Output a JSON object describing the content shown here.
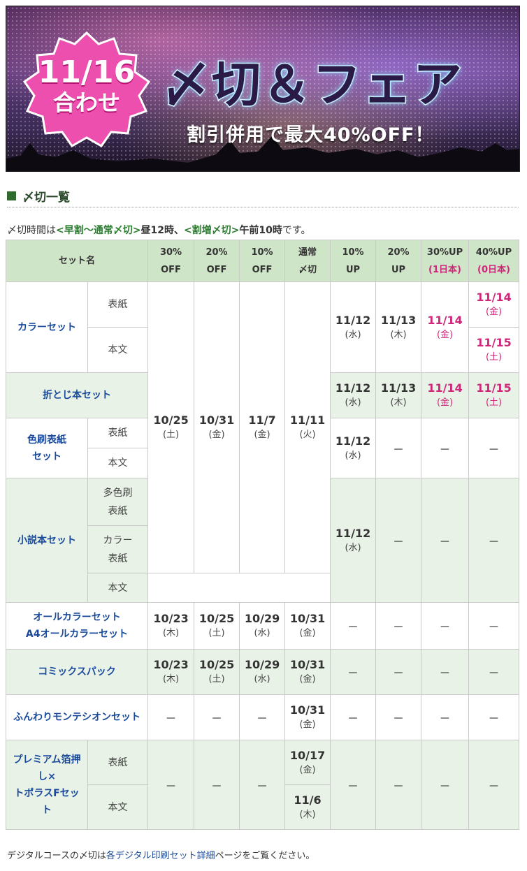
{
  "banner": {
    "badge_date": "11/16",
    "badge_sub": "合わせ",
    "title": "〆切＆フェア",
    "subtitle": "割引併用で最大40%OFF！",
    "colors": {
      "badge": "#ec4fae",
      "title": "#2a1a45",
      "glow": "#9fe3ff"
    }
  },
  "section": {
    "title": "〆切一覧"
  },
  "note": {
    "prefix": "〆切時間は",
    "early": "<早割〜通常〆切>",
    "early_time": "昼12時、",
    "extra": "<割増〆切>",
    "extra_time": "午前10時",
    "suffix": "です。"
  },
  "table": {
    "head": {
      "set_name": "セット名",
      "c1a": "30%",
      "c1b": "OFF",
      "c2a": "20%",
      "c2b": "OFF",
      "c3a": "10%",
      "c3b": "OFF",
      "c4a": "通常",
      "c4b": "〆切",
      "c5a": "10%",
      "c5b": "UP",
      "c6a": "20%",
      "c6b": "UP",
      "c7a": "30%UP",
      "c7b": "(1日本)",
      "c8a": "40%UP",
      "c8b": "(0日本)"
    },
    "dash": "－",
    "shared": {
      "off30": {
        "d": "10/25",
        "w": "(土)"
      },
      "off20": {
        "d": "10/31",
        "w": "(金)"
      },
      "off10": {
        "d": "11/7",
        "w": "(金)"
      },
      "normal": {
        "d": "11/11",
        "w": "(火)"
      }
    },
    "color_set": {
      "name": "カラーセット",
      "part1": "表紙",
      "part2": "本文",
      "up10": {
        "d": "11/12",
        "w": "(水)"
      },
      "up20": {
        "d": "11/13",
        "w": "(木)"
      },
      "up30": {
        "d": "11/14",
        "w": "(金)"
      },
      "up40_cover": {
        "d": "11/14",
        "w": "(金)"
      },
      "up40_body": {
        "d": "11/15",
        "w": "(土)"
      }
    },
    "fold_set": {
      "name": "折とじ本セット",
      "up10": {
        "d": "11/12",
        "w": "(水)"
      },
      "up20": {
        "d": "11/13",
        "w": "(木)"
      },
      "up30": {
        "d": "11/14",
        "w": "(金)"
      },
      "up40": {
        "d": "11/15",
        "w": "(土)"
      }
    },
    "tint_set": {
      "name1": "色刷表紙",
      "name2": "セット",
      "part1": "表紙",
      "part2": "本文",
      "up10": {
        "d": "11/12",
        "w": "(水)"
      }
    },
    "novel_set": {
      "name": "小説本セット",
      "part1a": "多色刷",
      "part1b": "表紙",
      "part2a": "カラー",
      "part2b": "表紙",
      "part3": "本文",
      "up10": {
        "d": "11/12",
        "w": "(水)"
      }
    },
    "allcolor_set": {
      "name1": "オールカラーセット",
      "name2": "A4オールカラーセット",
      "off30": {
        "d": "10/23",
        "w": "(木)"
      },
      "off20": {
        "d": "10/25",
        "w": "(土)"
      },
      "off10": {
        "d": "10/29",
        "w": "(水)"
      },
      "normal": {
        "d": "10/31",
        "w": "(金)"
      }
    },
    "comics_pack": {
      "name": "コミックスパック",
      "off30": {
        "d": "10/23",
        "w": "(木)"
      },
      "off20": {
        "d": "10/25",
        "w": "(土)"
      },
      "off10": {
        "d": "10/29",
        "w": "(水)"
      },
      "normal": {
        "d": "10/31",
        "w": "(金)"
      }
    },
    "funwari_set": {
      "name": "ふんわりモンテシオンセット",
      "normal": {
        "d": "10/31",
        "w": "(金)"
      }
    },
    "premium_set": {
      "name1": "プレミアム箔押",
      "name2": "し×",
      "name3": "トポラスFセッ",
      "name4": "ト",
      "part1": "表紙",
      "part2": "本文",
      "normal_cover": {
        "d": "10/17",
        "w": "(金)"
      },
      "normal_body": {
        "d": "11/6",
        "w": "(木)"
      }
    }
  },
  "footer": {
    "prefix": "デジタルコースの〆切は",
    "link": "各デジタル印刷セット詳細",
    "suffix": "ページをご覧ください。"
  }
}
